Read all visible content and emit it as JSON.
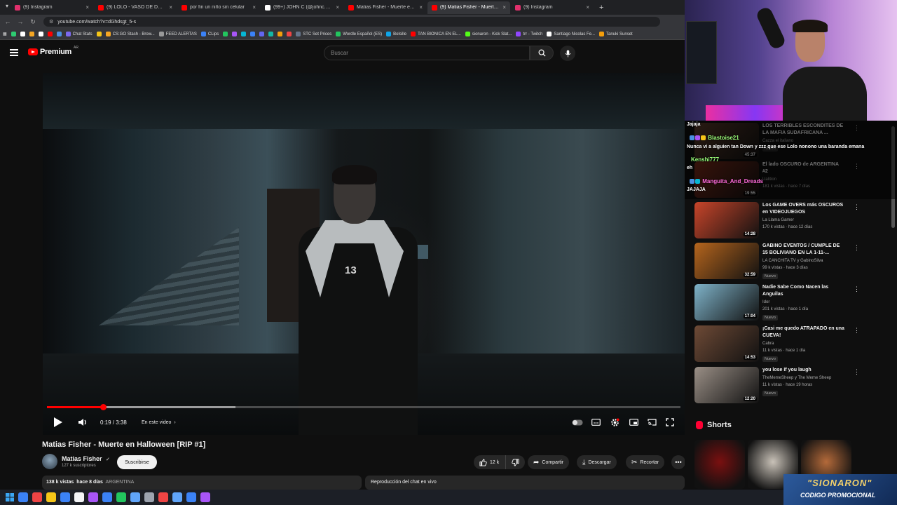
{
  "browser": {
    "tabs": [
      {
        "label": "(9) Instagram",
        "color": "#e1306c",
        "active": false
      },
      {
        "label": "(9) LOLO - VASO DE DOS (VIDEO",
        "color": "#ff0000",
        "active": false
      },
      {
        "label": "por fin un niño sin celular",
        "color": "#ff0000",
        "active": false
      },
      {
        "label": "(99+) JOHN C (@johnc.mrz)",
        "color": "#ffffff",
        "active": false
      },
      {
        "label": "Matias Fisher - Muerte en Hallo",
        "color": "#ff0000",
        "active": false
      },
      {
        "label": "(9) Matias Fisher - Muerte en Ha",
        "color": "#ff0000",
        "active": true
      },
      {
        "label": "(9) Instagram",
        "color": "#e1306c",
        "active": false
      }
    ],
    "url": "youtube.com/watch?v=dGhdsgt_5-s",
    "bookmarks": [
      {
        "label": "",
        "color": "#2ecc71"
      },
      {
        "label": "",
        "color": "#ffffff"
      },
      {
        "label": "",
        "color": "#f5a623"
      },
      {
        "label": "",
        "color": "#ffffff"
      },
      {
        "label": "",
        "color": "#ff0000"
      },
      {
        "label": "",
        "color": "#4a90e2"
      },
      {
        "label": "Chat Stats",
        "color": "#7b68ee"
      },
      {
        "label": "",
        "color": "#f5c518"
      },
      {
        "label": "CS:GO Stash - Brow...",
        "color": "#f5a623"
      },
      {
        "label": "FEED ALERTAS",
        "color": "#999999"
      },
      {
        "label": "CLips",
        "color": "#3b82f6"
      },
      {
        "label": "",
        "color": "#22c55e"
      },
      {
        "label": "",
        "color": "#a855f7"
      },
      {
        "label": "",
        "color": "#06b6d4"
      },
      {
        "label": "",
        "color": "#3b82f6"
      },
      {
        "label": "",
        "color": "#6366f1"
      },
      {
        "label": "",
        "color": "#14b8a6"
      },
      {
        "label": "",
        "color": "#f59e0b"
      },
      {
        "label": "",
        "color": "#ef4444"
      },
      {
        "label": "STC Set Prices",
        "color": "#64748b"
      },
      {
        "label": "Wordle Español (ES)",
        "color": "#22c55e"
      },
      {
        "label": "Bolsille",
        "color": "#0ea5e9"
      },
      {
        "label": "TAN BIONICA EN EL...",
        "color": "#ff0000"
      },
      {
        "label": "sionaron - Kick Slat...",
        "color": "#53fc18"
      },
      {
        "label": "trr - Twitch",
        "color": "#9146ff"
      },
      {
        "label": "Santiago Nicolas Fe...",
        "color": "#ffffff"
      },
      {
        "label": "Tanuki Sunset",
        "color": "#f59e0b"
      }
    ]
  },
  "header": {
    "logo_text": "Premium",
    "country": "AR",
    "search_placeholder": "Buscar"
  },
  "player": {
    "progress_played": 0.088,
    "progress_loaded": 0.298,
    "time_label": "0:19 / 3:38",
    "chapter_label": "En este video",
    "jersey_number": "13"
  },
  "video": {
    "title": "Matias Fisher - Muerte en Halloween [RIP #1]",
    "channel": "Matias Fisher",
    "subscribers": "127 k suscriptores",
    "subscribe_label": "Suscribirse",
    "likes": "12 k",
    "share_label": "Compartir",
    "download_label": "Descargar",
    "clip_label": "Recortar",
    "views": "138 k vistas",
    "age": "hace 8 días",
    "tag": "ARGENTINA",
    "chat_replay_label": "Reproducción del chat en vivo"
  },
  "chat": {
    "messages": [
      {
        "user": "",
        "text": "Jajaja"
      },
      {
        "user": "Blastoise21",
        "user_color": "#9bff7a",
        "text": "Nunca vi a alguien tan Down y zzz que ese Lolo nonono una baranda emana"
      },
      {
        "user": "Kenshi777",
        "user_color": "#9bff7a",
        "text": "eh"
      },
      {
        "user": "Manguita_And_Dreads",
        "user_color": "#ff6bdc",
        "text": "JAJAJA"
      }
    ]
  },
  "recommendations": [
    {
      "title": "LOS TERRIBLES ESCONDITES DE LA MAFIA SUDAFRICANA ...",
      "channel": "Cazza el italiano",
      "meta": "",
      "duration": "45:37",
      "badge": "Nuevo",
      "color": "#5a3a2a"
    },
    {
      "title": "El lado OSCURO de ARGENTINA #2",
      "channel": "Ualition",
      "meta": "181 k vistas · hace 7 días",
      "duration": "19:55",
      "badge": "",
      "color": "#7a2a1a"
    },
    {
      "title": "Los GAME OVERS más OSCUROS en VIDEOJUEGOS",
      "channel": "La Llama Gamer",
      "meta": "170 k vistas · hace 12 días",
      "duration": "14:28",
      "badge": "",
      "color": "#c8452a"
    },
    {
      "title": "GABINO EVENTOS / CUMPLE DE 15 BOLIVIANO EN LA 1-11-...",
      "channel": "LA CANCHITA TV y GabinoSilva",
      "meta": "99 k vistas · hace 3 días",
      "duration": "32:59",
      "badge": "Nuevo",
      "color": "#b5651d"
    },
    {
      "title": "Nadie Sabe Como Nacen las Anguilas",
      "channel": "Idor",
      "meta": "201 k vistas · hace 1 día",
      "duration": "17:04",
      "badge": "Nuevo",
      "color": "#7fb3c9"
    },
    {
      "title": "¡Casi me quedo ATRAPADO en una CUEVA!",
      "channel": "Cabra",
      "meta": "11 k vistas · hace 1 día",
      "duration": "14:53",
      "badge": "Nuevo",
      "color": "#6e4a36"
    },
    {
      "title": "you lose if you laugh",
      "channel": "TheMemeSheep y The Meme Sheep",
      "meta": "11 k vistas · hace 19 horas",
      "duration": "12:20",
      "badge": "Nuevo",
      "color": "#9a8f86"
    }
  ],
  "shorts": {
    "heading": "Shorts",
    "colors": [
      "#7a1010",
      "#c9c2b8",
      "#b46a3a"
    ]
  },
  "promo": {
    "line1": "\"SIONARON\"",
    "line2": "CODIGO PROMOCIONAL"
  },
  "taskbar": {
    "icons": [
      "#3b82f6",
      "#ef4444",
      "#f5c518",
      "#3b82f6",
      "#f3f4f6",
      "#a855f7",
      "#3b82f6",
      "#22c55e",
      "#60a5fa",
      "#9ca3af",
      "#ef4444",
      "#60a5fa",
      "#3b82f6",
      "#a855f7"
    ]
  }
}
